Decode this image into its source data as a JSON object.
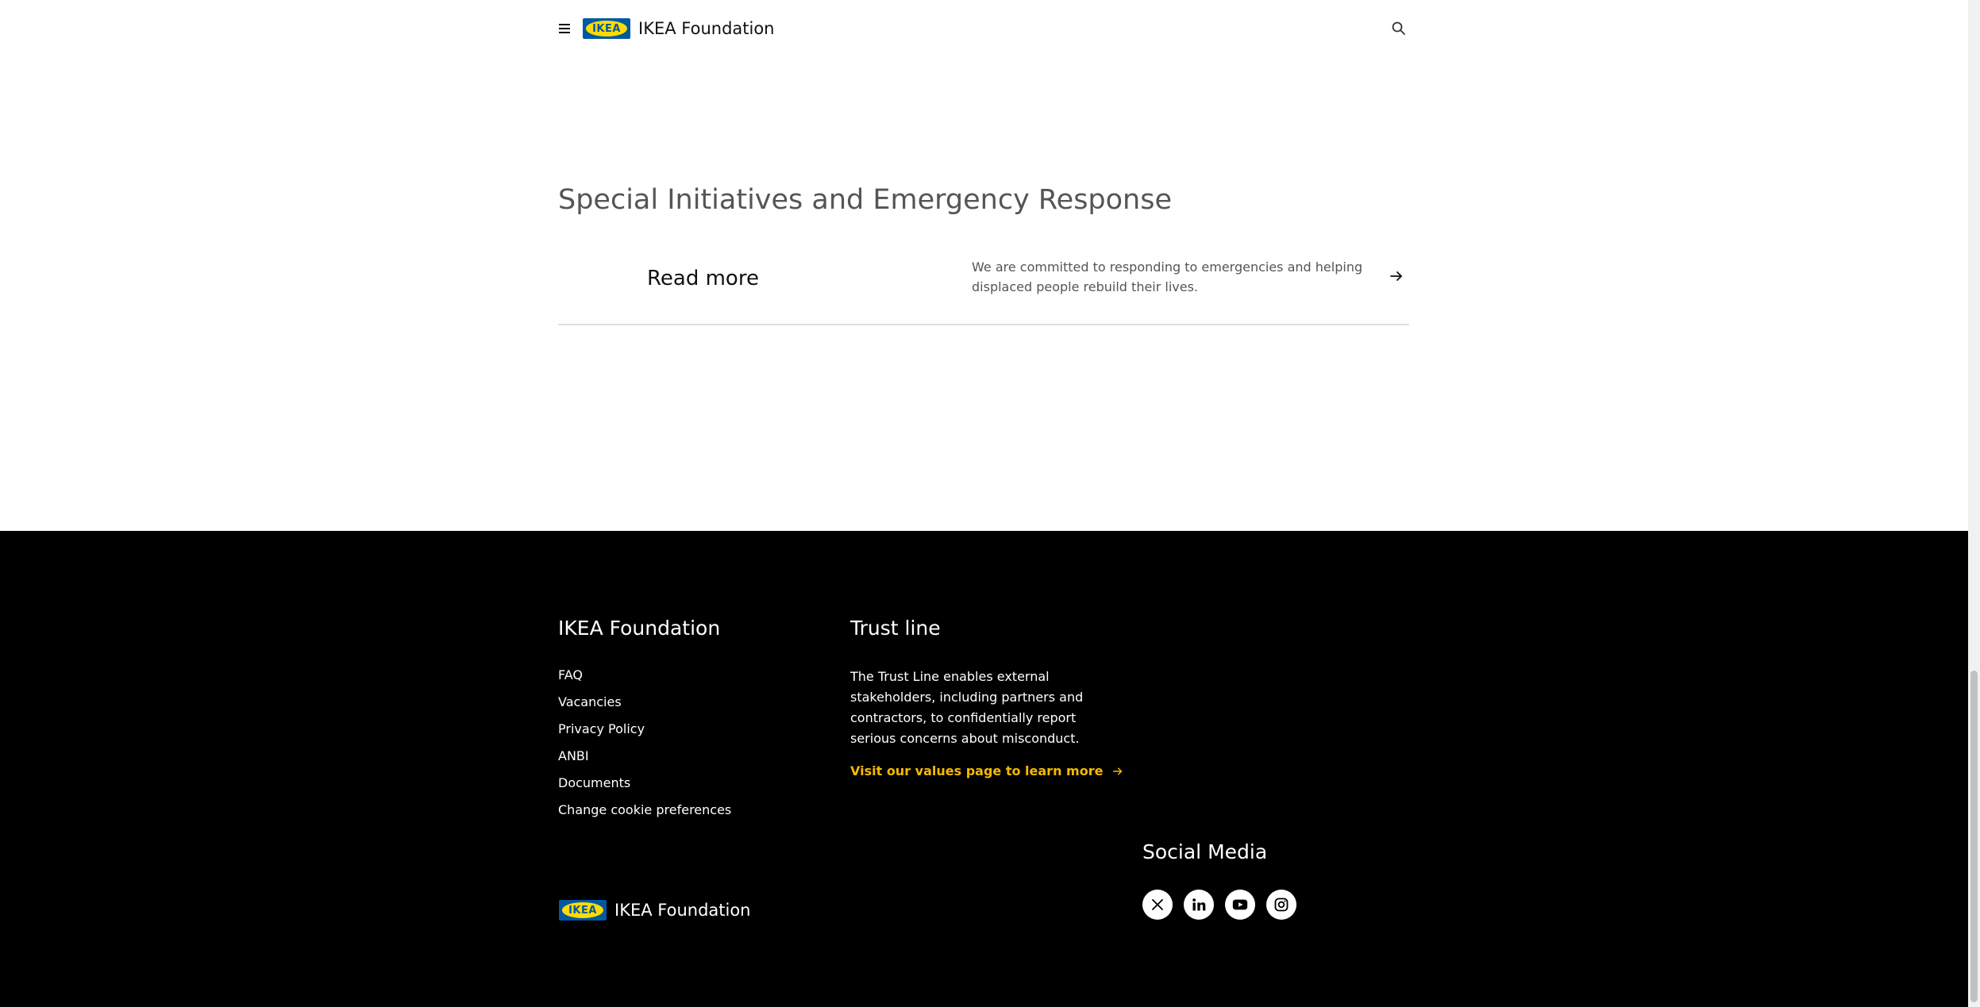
{
  "header": {
    "logo_text": "IKEA",
    "title": "IKEA Foundation",
    "menu_icon": "hamburger-menu-icon",
    "search_icon": "search-icon"
  },
  "main": {
    "section_title": "Special Initiatives and Emergency Response",
    "read_more": {
      "label": "Read more",
      "description": "We are committed to responding to emergencies and helping displaced people rebuild their lives.",
      "icon": "arrow-right-icon"
    }
  },
  "footer": {
    "brand_heading": "IKEA Foundation",
    "links": [
      "FAQ",
      "Vacancies",
      "Privacy Policy",
      "ANBI",
      "Documents",
      "Change cookie preferences"
    ],
    "trust_heading": "Trust line",
    "trust_text": "The Trust Line enables external stakeholders, including partners and contractors, to confidentially report serious concerns about misconduct.",
    "trust_link": "Visit our values page to learn more",
    "social_heading": "Social Media",
    "social_icons": [
      "x-icon",
      "linkedin-icon",
      "youtube-icon",
      "instagram-icon"
    ],
    "logo_text": "IKEA",
    "brand_name": "IKEA Foundation"
  },
  "colors": {
    "ikea_blue": "#0058a3",
    "ikea_yellow": "#ffdb00",
    "link_accent": "#f5b800",
    "footer_bg": "#000000"
  }
}
